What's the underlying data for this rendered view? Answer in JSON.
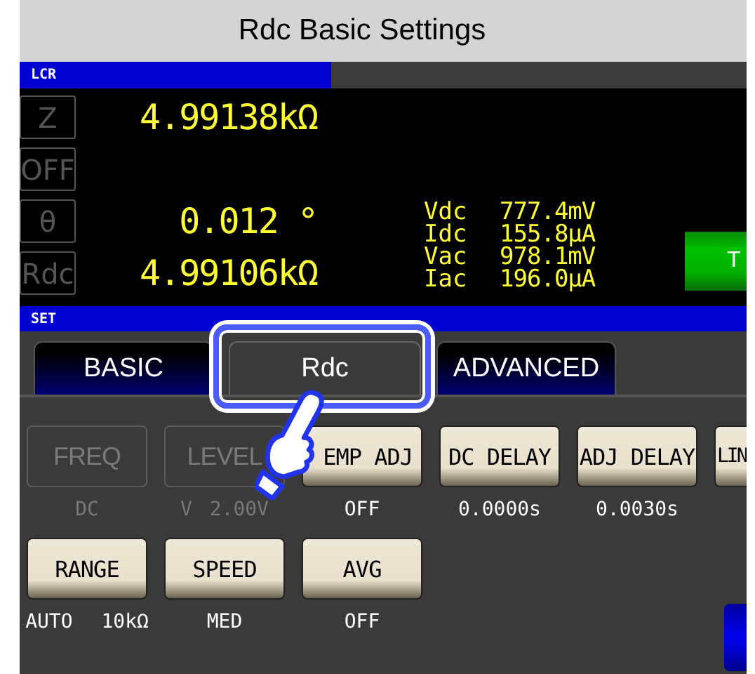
{
  "title": "Rdc Basic Settings",
  "lcr_header": {
    "label": "LCR"
  },
  "parameters": [
    {
      "label": "Z",
      "value": "4.99138kΩ"
    },
    {
      "label": "OFF"
    },
    {
      "label": "θ",
      "value": "0.012 °"
    },
    {
      "label": "Rdc",
      "value": "4.99106kΩ"
    }
  ],
  "monitor": [
    {
      "label": "Vdc",
      "value": "777.4mV"
    },
    {
      "label": "Idc",
      "value": "155.8μA"
    },
    {
      "label": "Vac",
      "value": "978.1mV"
    },
    {
      "label": "Iac",
      "value": "196.0μA"
    }
  ],
  "side_button": {
    "label": "T"
  },
  "set_header": {
    "label": "SET"
  },
  "tabs": [
    {
      "label": "BASIC",
      "selected": false
    },
    {
      "label": "Rdc",
      "selected": true
    },
    {
      "label": "ADVANCED",
      "selected": false
    }
  ],
  "settings_rows": [
    [
      {
        "label": "FREQ",
        "value": "DC",
        "disabled": true
      },
      {
        "label": "LEVEL",
        "value": "V 2.00V",
        "disabled": true
      },
      {
        "label": "EMP ADJ",
        "value": "OFF",
        "disabled": false
      },
      {
        "label": "DC DELAY",
        "value": "0.0000s",
        "disabled": false
      },
      {
        "label": "ADJ DELAY",
        "value": "0.0030s",
        "disabled": false
      },
      {
        "label": "LIN",
        "disabled": false
      }
    ],
    [
      {
        "label": "RANGE",
        "value": "AUTO 10kΩ",
        "disabled": false
      },
      {
        "label": "SPEED",
        "value": "MED",
        "disabled": false
      },
      {
        "label": "AVG",
        "value": "OFF",
        "disabled": false
      }
    ]
  ]
}
